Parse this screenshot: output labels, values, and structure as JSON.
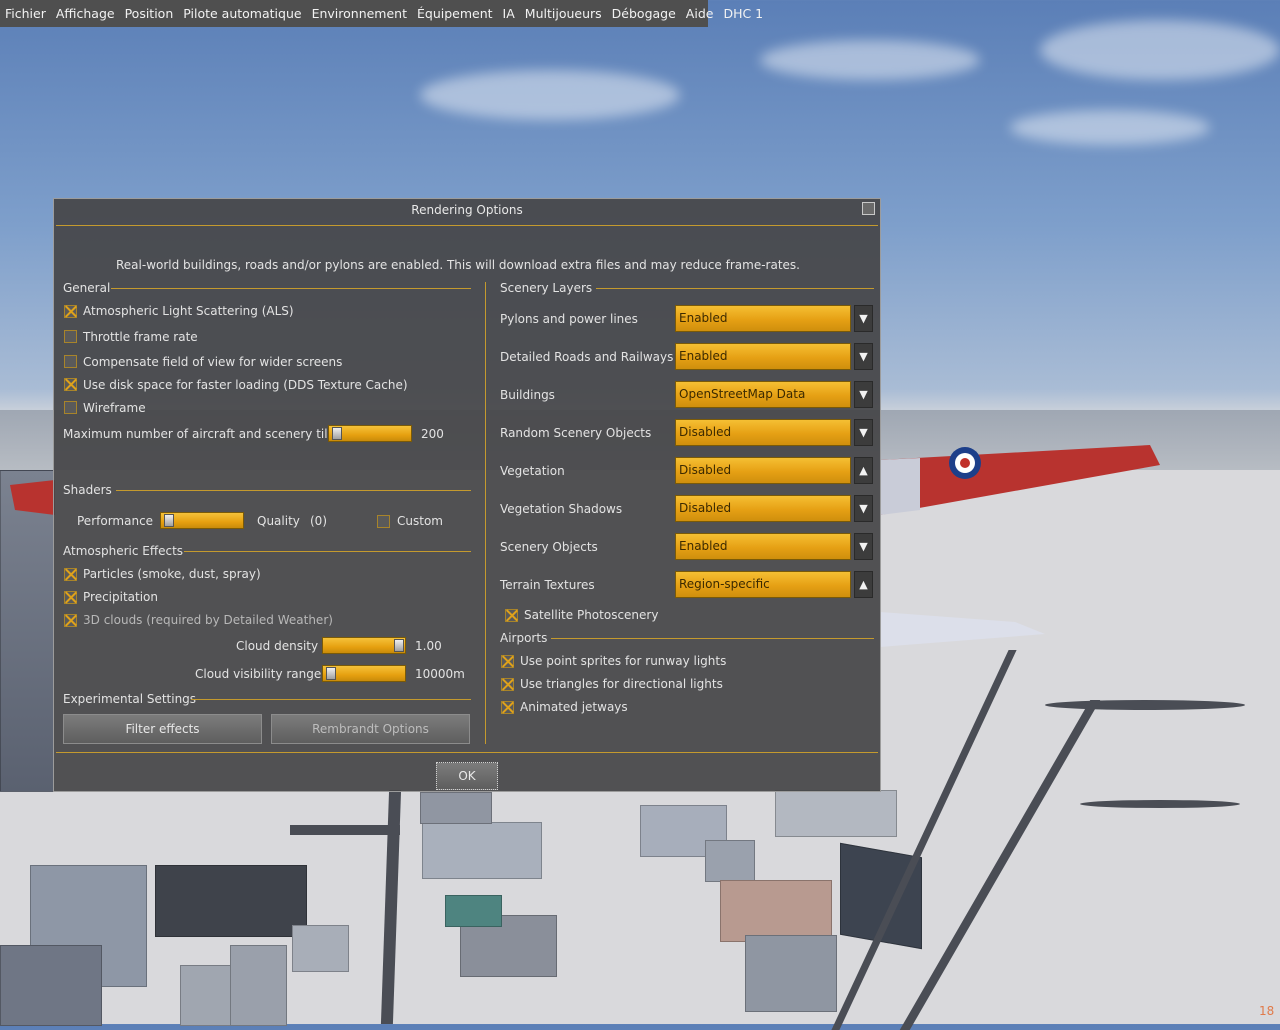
{
  "menubar": {
    "items": [
      "Fichier",
      "Affichage",
      "Position",
      "Pilote automatique",
      "Environnement",
      "Équipement",
      "IA",
      "Multijoueurs",
      "Débogage",
      "Aide",
      "DHC 1"
    ]
  },
  "dialog": {
    "title": "Rendering Options",
    "notice": "Real-world buildings, roads and/or pylons are enabled. This will download extra files and may reduce frame-rates.",
    "general": {
      "heading": "General",
      "als": {
        "label": "Atmospheric Light Scattering (ALS)",
        "checked": true
      },
      "throttle": {
        "label": "Throttle frame rate",
        "checked": false
      },
      "fov": {
        "label": "Compensate field of view for wider screens",
        "checked": false
      },
      "dds": {
        "label": "Use disk space for faster loading (DDS Texture Cache)",
        "checked": true
      },
      "wireframe": {
        "label": "Wireframe",
        "checked": false
      },
      "tiles": {
        "label": "Maximum number of aircraft and scenery tiles",
        "value": "200"
      }
    },
    "shaders": {
      "heading": "Shaders",
      "performance_label": "Performance",
      "quality_label": "Quality",
      "quality_value": "(0)",
      "custom": {
        "label": "Custom",
        "checked": false
      }
    },
    "atmospheric": {
      "heading": "Atmospheric Effects",
      "particles": {
        "label": "Particles (smoke, dust, spray)",
        "checked": true
      },
      "precipitation": {
        "label": "Precipitation",
        "checked": true
      },
      "clouds3d": {
        "label": "3D clouds (required by Detailed Weather)",
        "checked": true
      },
      "cloud_density": {
        "label": "Cloud density",
        "value": "1.00"
      },
      "cloud_visibility": {
        "label": "Cloud visibility range",
        "value": "10000m"
      }
    },
    "experimental": {
      "heading": "Experimental Settings",
      "filter_button": "Filter effects",
      "rembrandt_button": "Rembrandt Options"
    },
    "scenery": {
      "heading": "Scenery Layers",
      "rows": [
        {
          "label": "Pylons and power lines",
          "value": "Enabled",
          "arrow": "▼"
        },
        {
          "label": "Detailed Roads and Railways",
          "value": "Enabled",
          "arrow": "▼"
        },
        {
          "label": "Buildings",
          "value": "OpenStreetMap Data",
          "arrow": "▼"
        },
        {
          "label": "Random Scenery Objects",
          "value": "Disabled",
          "arrow": "▼"
        },
        {
          "label": "Vegetation",
          "value": "Disabled",
          "arrow": "▲"
        },
        {
          "label": "Vegetation Shadows",
          "value": "Disabled",
          "arrow": "▼"
        },
        {
          "label": "Scenery Objects",
          "value": "Enabled",
          "arrow": "▼"
        },
        {
          "label": "Terrain Textures",
          "value": "Region-specific",
          "arrow": "▲"
        }
      ],
      "satellite": {
        "label": "Satellite Photoscenery",
        "checked": true
      }
    },
    "airports": {
      "heading": "Airports",
      "sprites": {
        "label": "Use point sprites for runway lights",
        "checked": true
      },
      "triangles": {
        "label": "Use triangles for directional lights",
        "checked": true
      },
      "jetways": {
        "label": "Animated jetways",
        "checked": true
      }
    },
    "ok_button": "OK"
  },
  "fps": "18",
  "colors": {
    "accent": "#e6a014",
    "divider": "#c49a2e",
    "panel": "#464648"
  }
}
